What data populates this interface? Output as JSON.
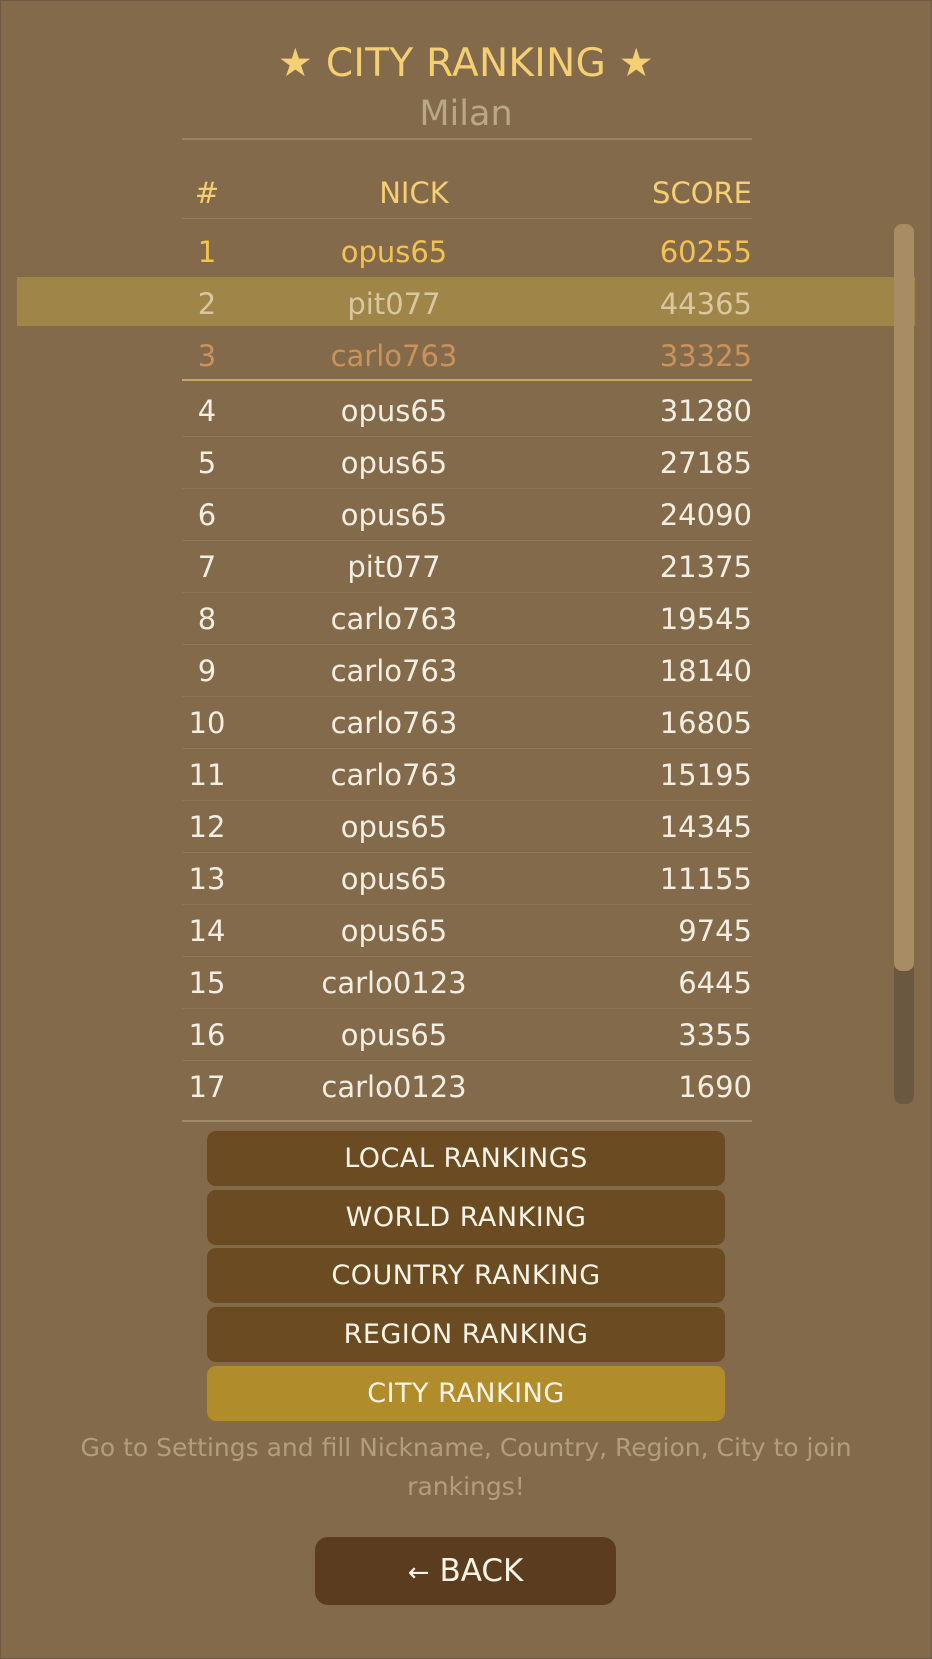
{
  "header": {
    "title": "★ CITY RANKING ★",
    "city": "Milan"
  },
  "table": {
    "columns": [
      "#",
      "NICK",
      "SCORE"
    ],
    "highlighted_rank": "2",
    "rows": [
      {
        "rank": "1",
        "nick": "opus65",
        "score": "60255"
      },
      {
        "rank": "2",
        "nick": "pit077",
        "score": "44365"
      },
      {
        "rank": "3",
        "nick": "carlo763",
        "score": "33325"
      },
      {
        "rank": "4",
        "nick": "opus65",
        "score": "31280"
      },
      {
        "rank": "5",
        "nick": "opus65",
        "score": "27185"
      },
      {
        "rank": "6",
        "nick": "opus65",
        "score": "24090"
      },
      {
        "rank": "7",
        "nick": "pit077",
        "score": "21375"
      },
      {
        "rank": "8",
        "nick": "carlo763",
        "score": "19545"
      },
      {
        "rank": "9",
        "nick": "carlo763",
        "score": "18140"
      },
      {
        "rank": "10",
        "nick": "carlo763",
        "score": "16805"
      },
      {
        "rank": "11",
        "nick": "carlo763",
        "score": "15195"
      },
      {
        "rank": "12",
        "nick": "opus65",
        "score": "14345"
      },
      {
        "rank": "13",
        "nick": "opus65",
        "score": "11155"
      },
      {
        "rank": "14",
        "nick": "opus65",
        "score": "9745"
      },
      {
        "rank": "15",
        "nick": "carlo0123",
        "score": "6445"
      },
      {
        "rank": "16",
        "nick": "opus65",
        "score": "3355"
      },
      {
        "rank": "17",
        "nick": "carlo0123",
        "score": "1690"
      }
    ]
  },
  "ranking_buttons": {
    "local": "LOCAL RANKINGS",
    "world": "WORLD RANKING",
    "country": "COUNTRY RANKING",
    "region": "REGION RANKING",
    "city": "CITY RANKING",
    "active": "city"
  },
  "notice": "Go to Settings and fill Nickname, Country, Region, City to join rankings!",
  "back_button": {
    "arrow": "←",
    "label": "BACK"
  },
  "colors": {
    "background": "#836a4b",
    "gold": "#f4cf73",
    "button": "#6b4b22",
    "button_active": "#b18c2a",
    "back_button": "#5b3c1f"
  }
}
